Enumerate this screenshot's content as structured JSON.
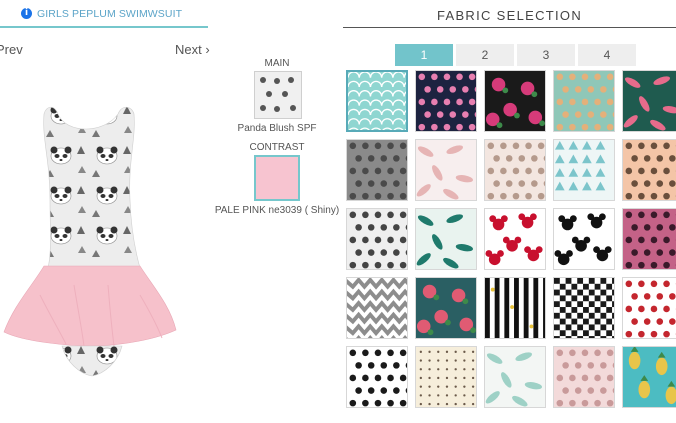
{
  "product": {
    "title": "GIRLS PEPLUM SWIMWSUIT",
    "prev_label": "Prev",
    "next_label": "Next ›"
  },
  "selection": {
    "main_label": "MAIN",
    "main_fabric": "Panda Blush SPF",
    "contrast_label": "CONTRAST",
    "contrast_fabric": "PALE PINK ne3039 ( Shiny)"
  },
  "fabric": {
    "title": "FABRIC SELECTION",
    "tabs": [
      "1",
      "2",
      "3",
      "4"
    ],
    "active_tab": "1",
    "swatches": [
      {
        "name": "scallop-mint",
        "pattern": "scales",
        "bg": "#8fd6d1",
        "fg": "#ffffff"
      },
      {
        "name": "unicorn-navy",
        "pattern": "dots",
        "bg": "#1d2340",
        "fg": "#e77fb0"
      },
      {
        "name": "roses-black",
        "pattern": "florals",
        "bg": "#1a1a1a",
        "fg": "#d63b7a"
      },
      {
        "name": "donuts-mint",
        "pattern": "dots",
        "bg": "#8fc7b8",
        "fg": "#e4b07a"
      },
      {
        "name": "flamingo-teal",
        "pattern": "leaves",
        "bg": "#1f5b4f",
        "fg": "#e66b8b"
      },
      {
        "name": "elephants-grey",
        "pattern": "dots",
        "bg": "#8a8a8a",
        "fg": "#4a4a4a"
      },
      {
        "name": "pink-feathers",
        "pattern": "leaves",
        "bg": "#f7eeee",
        "fg": "#e6b4b4"
      },
      {
        "name": "sloths-blush",
        "pattern": "dots",
        "bg": "#f3e6e0",
        "fg": "#b59a8c"
      },
      {
        "name": "diamonds-mint",
        "pattern": "tri",
        "bg": "#eef6f6",
        "fg": "#7cc5cb"
      },
      {
        "name": "cats-peach",
        "pattern": "dots",
        "bg": "#f4c5a7",
        "fg": "#6a4f3c"
      },
      {
        "name": "panda-blush",
        "pattern": "dots",
        "bg": "#efefef",
        "fg": "#444444"
      },
      {
        "name": "tropical-palm",
        "pattern": "leaves",
        "bg": "#e9f3ef",
        "fg": "#1f7a6c"
      },
      {
        "name": "minnie-red",
        "pattern": "mouse",
        "bg": "#ffffff",
        "fg": "#c8102e"
      },
      {
        "name": "mickey-black",
        "pattern": "mouse",
        "bg": "#ffffff",
        "fg": "#111111"
      },
      {
        "name": "leopard-pink",
        "pattern": "dots",
        "bg": "#c46287",
        "fg": "#3a1a2a"
      },
      {
        "name": "chevron-grey",
        "pattern": "chevron",
        "bg": "#ffffff",
        "fg": "#8d8d8d"
      },
      {
        "name": "watermelon-teal",
        "pattern": "florals",
        "bg": "#2a5f63",
        "fg": "#e05b73"
      },
      {
        "name": "stripes-stars",
        "pattern": "stripes",
        "bg": "#ffffff",
        "fg": "#111111"
      },
      {
        "name": "houndstooth",
        "pattern": "check",
        "bg": "#ffffff",
        "fg": "#1a1a1a"
      },
      {
        "name": "cherries-white",
        "pattern": "dots",
        "bg": "#ffffff",
        "fg": "#c4262e"
      },
      {
        "name": "dalmatian",
        "pattern": "dots",
        "bg": "#ffffff",
        "fg": "#1a1a1a"
      },
      {
        "name": "cream-dots",
        "pattern": "smalldots",
        "bg": "#f6eedb",
        "fg": "#6b5a4a"
      },
      {
        "name": "pastel-feathers",
        "pattern": "leaves",
        "bg": "#f3f6f4",
        "fg": "#9ed1c6"
      },
      {
        "name": "llama-pink",
        "pattern": "dots",
        "bg": "#f3dada",
        "fg": "#c99a9a"
      },
      {
        "name": "pineapple-teal",
        "pattern": "pine",
        "bg": "#4cbcc2",
        "fg": "#e8c54a"
      }
    ]
  },
  "colors": {
    "accent": "#76c7cc",
    "contrast_fabric": "#f7c4d0",
    "link_blue": "#5ba4c8"
  }
}
